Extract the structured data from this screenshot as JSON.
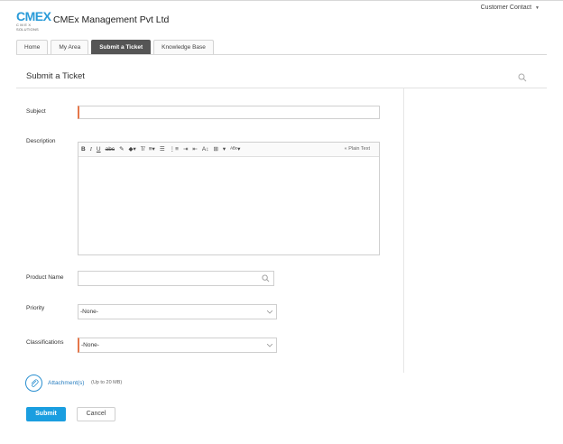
{
  "header": {
    "logo_text": "CMEX",
    "logo_subtext": "C M E X SOLUTIONS",
    "company_name": "CMEx Management Pvt Ltd",
    "user_menu_label": "Customer Contact"
  },
  "tabs": [
    {
      "label": "Home",
      "active": false
    },
    {
      "label": "My Area",
      "active": false
    },
    {
      "label": "Submit a Ticket",
      "active": true
    },
    {
      "label": "Knowledge Base",
      "active": false
    }
  ],
  "page": {
    "title": "Submit a Ticket",
    "search_icon": "search-icon"
  },
  "form": {
    "subject_label": "Subject",
    "subject_value": "",
    "description_label": "Description",
    "editor_toolbar": [
      "B",
      "I",
      "U",
      "abc",
      "font-color",
      "background-color",
      "clear-format",
      "align",
      "bullet-list",
      "numbered-list",
      "indent",
      "outdent",
      "font-size",
      "table",
      "insert",
      "spell-check"
    ],
    "plain_text_label": "« Plain Text",
    "product_label": "Product Name",
    "product_value": "",
    "priority_label": "Priority",
    "priority_value": "-None-",
    "classifications_label": "Classifications",
    "classifications_value": "-None-"
  },
  "attachment": {
    "link_label": "Attachment(s)",
    "note": "(Up to 20 MB)"
  },
  "buttons": {
    "submit": "Submit",
    "cancel": "Cancel"
  },
  "colors": {
    "accent": "#1a9ee0",
    "required": "#e5774a",
    "active_tab": "#555555"
  }
}
